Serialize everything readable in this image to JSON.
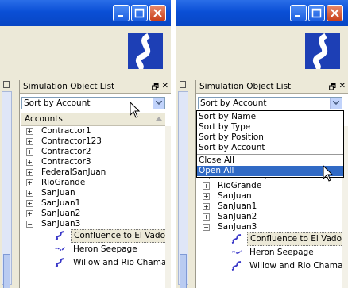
{
  "left": {
    "panel_title": "Simulation Object List",
    "combo_value": "Sort by Account",
    "accounts_header": "Accounts",
    "tree_items": [
      "Contractor1",
      "Contractor123",
      "Contractor2",
      "Contractor3",
      "FederalSanJuan",
      "RioGrande",
      "SanJuan",
      "SanJuan1",
      "SanJuan2",
      "SanJuan3"
    ],
    "children": [
      "Confluence to El Vado",
      "Heron Seepage",
      "Willow and Rio Chama"
    ]
  },
  "right": {
    "panel_title": "Simulation Object List",
    "combo_value": "Sort by Account",
    "menu_options": [
      "Sort by Name",
      "Sort by Type",
      "Sort by Position",
      "Sort by Account"
    ],
    "menu_actions": [
      "Close All",
      "Open All"
    ],
    "tree_items_partial": [
      "FederalSanJuan",
      "RioGrande",
      "SanJuan",
      "SanJuan1",
      "SanJuan2",
      "SanJuan3"
    ],
    "children": [
      "Confluence to El Vado",
      "Heron Seepage",
      "Willow and Rio Chama"
    ]
  },
  "dock_icons": {
    "float": "🗗",
    "close": "✕"
  },
  "colors": {
    "titlebar": "#0a4fd6",
    "highlight": "#316ac5",
    "logo": "#1d3fb5"
  }
}
